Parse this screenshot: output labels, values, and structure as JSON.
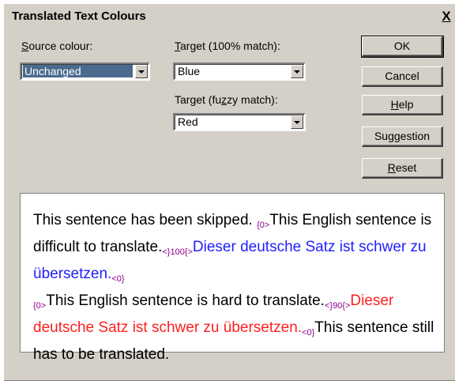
{
  "window": {
    "title": "Translated Text Colours",
    "close_glyph": "X"
  },
  "fields": {
    "source_label_u": "S",
    "source_label_rest": "ource colour:",
    "source_value": "Unchanged",
    "target100_label_u": "T",
    "target100_label_rest": "arget (100% match):",
    "target100_value": "Blue",
    "targetfuzzy_label_pre": "Target (fu",
    "targetfuzzy_label_u": "z",
    "targetfuzzy_label_post": "zy match):",
    "targetfuzzy_value": "Red"
  },
  "buttons": {
    "ok": "OK",
    "cancel": "Cancel",
    "help_u": "H",
    "help_rest": "elp",
    "suggestion_pre": "Su",
    "suggestion_u": "g",
    "suggestion_post": "gestion",
    "reset_u": "R",
    "reset_rest": "eset"
  },
  "preview": {
    "seg1": "This sentence has been skipped. ",
    "tag1": "{0>",
    "seg2": "This English sentence is difficult to translate.",
    "tag2": "<}100{>",
    "seg3": "Dieser deutsche Satz ist schwer zu übersetzen.",
    "tag3": "<0}",
    "tag4": "{0>",
    "seg4": "This English sentence is hard to translate.",
    "tag5": "<}90{>",
    "seg5": "Dieser deutsche Satz ist schwer zu übersetzen.",
    "tag6": "<0}",
    "seg6": "This sentence still has to be translated."
  },
  "colors": {
    "dialog_bg": "#d4d0c8",
    "match_100": "#2020ff",
    "match_fuzzy": "#ff2020",
    "tag": "#8b008b"
  }
}
